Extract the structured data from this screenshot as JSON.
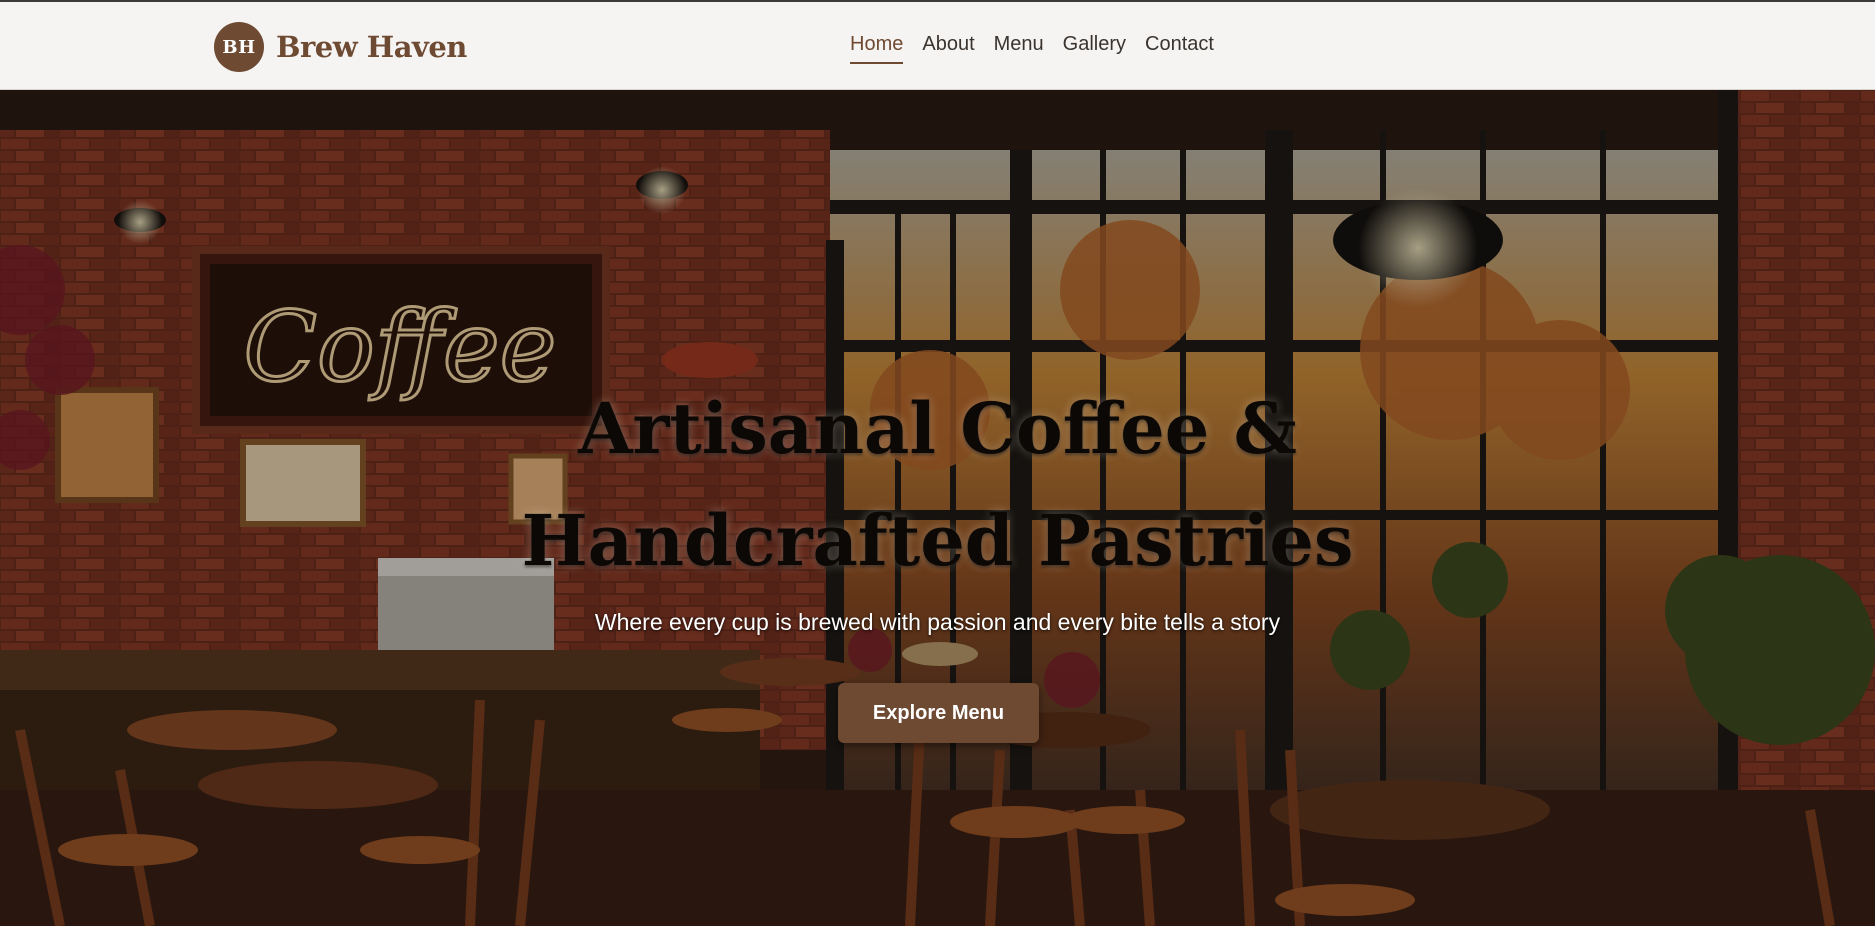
{
  "brand": {
    "initials": "BH",
    "name": "Brew Haven"
  },
  "nav": {
    "items": [
      {
        "label": "Home",
        "active": true
      },
      {
        "label": "About",
        "active": false
      },
      {
        "label": "Menu",
        "active": false
      },
      {
        "label": "Gallery",
        "active": false
      },
      {
        "label": "Contact",
        "active": false
      }
    ]
  },
  "hero": {
    "title_line1": "Artisanal Coffee &",
    "title_line2": "Handcrafted Pastries",
    "subtitle": "Where every cup is brewed with passion and every bite tells a story",
    "cta_label": "Explore Menu",
    "sign_text": "Coffee"
  },
  "colors": {
    "accent": "#6e4a33",
    "header_bg": "#f5f4f2",
    "nav_text": "#3a3430"
  }
}
